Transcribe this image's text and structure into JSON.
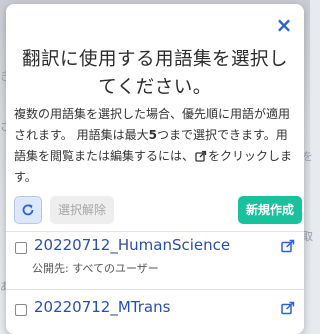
{
  "background": {
    "edge_fragments": [
      "き",
      "さ",
      "を",
      "取",
      "あ"
    ]
  },
  "modal": {
    "close_symbol": "×",
    "title": "翻訳に使用する用語集を選択してください。",
    "description": {
      "part1": "複数の用語集を選択した場合、優先順に用語が適用されます。 用語集は最大",
      "max_count": "5",
      "part2": "つまで選択できます。用語集を閲覧または編集するには、",
      "part3": "をクリックします。"
    },
    "toolbar": {
      "refresh_icon": "refresh-icon",
      "deselect_label": "選択解除",
      "new_label": "新規作成"
    },
    "glossaries": [
      {
        "name": "20220712_HumanScience",
        "visibility": "公開先: すべてのユーザー",
        "checked": false
      },
      {
        "name": "20220712_MTrans",
        "visibility": "",
        "checked": false
      }
    ]
  },
  "colors": {
    "accent_blue": "#2a63d4",
    "link_blue": "#2a4fa8",
    "new_button_green": "#18c29c",
    "disabled_gray": "#eeeeee"
  }
}
